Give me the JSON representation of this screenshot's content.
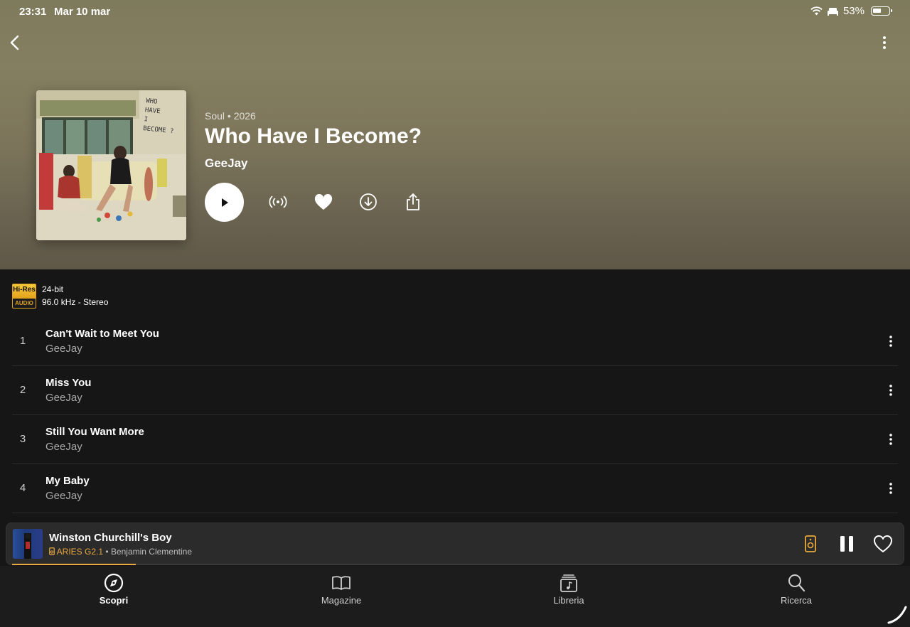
{
  "status": {
    "time": "23:31",
    "date": "Mar 10 mar",
    "battery": "53%",
    "battery_level": 0.53
  },
  "album": {
    "meta": "Soul • 2026",
    "title": "Who Have I Become?",
    "artist": "GeeJay",
    "cover_text": [
      "WHO",
      "HAVE",
      "I",
      "BECOME ?"
    ]
  },
  "quality": {
    "badge_top": "Hi-Res",
    "badge_bottom": "AUDIO",
    "bits": "24-bit",
    "rate": "96.0 kHz - Stereo"
  },
  "tracks": [
    {
      "number": "1",
      "title": "Can't Wait to Meet You",
      "artist": "GeeJay"
    },
    {
      "number": "2",
      "title": "Miss You",
      "artist": "GeeJay"
    },
    {
      "number": "3",
      "title": "Still You Want More",
      "artist": "GeeJay"
    },
    {
      "number": "4",
      "title": "My Baby",
      "artist": "GeeJay"
    }
  ],
  "now_playing": {
    "title": "Winston Churchill's Boy",
    "device": "ARIES G2.1",
    "separator": "•",
    "artist": "Benjamin Clementine",
    "progress": 0.14
  },
  "tabs": [
    {
      "label": "Scopri",
      "icon": "compass-icon",
      "active": true
    },
    {
      "label": "Magazine",
      "icon": "book-icon",
      "active": false
    },
    {
      "label": "Libreria",
      "icon": "library-icon",
      "active": false
    },
    {
      "label": "Ricerca",
      "icon": "search-icon",
      "active": false
    }
  ],
  "colors": {
    "accent": "#e9a93d",
    "background": "#161616",
    "hero": "#857f61"
  }
}
